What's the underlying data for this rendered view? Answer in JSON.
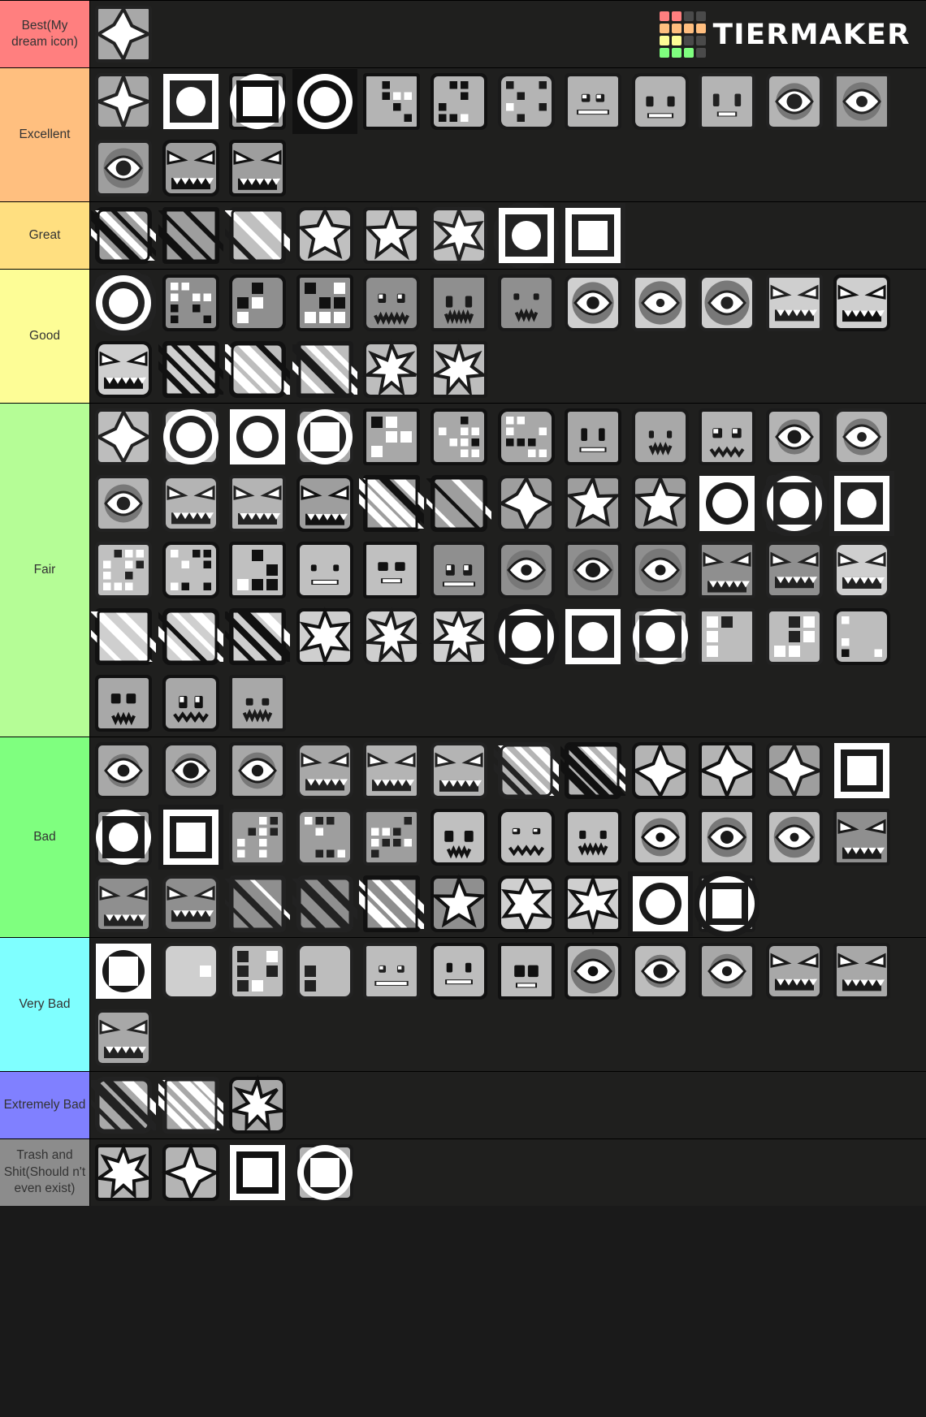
{
  "brand": {
    "name": "TIERMAKER",
    "logo_icon": "tiermaker-grid-logo",
    "logo_colors": [
      "#ff7f7f",
      "#ff7f7f",
      "#4a4a4a",
      "#4a4a4a",
      "#ffbe7f",
      "#ffbe7f",
      "#ffbe7f",
      "#ffbe7f",
      "#fdfd96",
      "#fdfd96",
      "#4a4a4a",
      "#4a4a4a",
      "#7fff7f",
      "#7fff7f",
      "#7fff7f",
      "#4a4a4a"
    ]
  },
  "palette": {
    "background": "#1a1a1a",
    "cell_background": "#1f1f1e",
    "divider": "#000000",
    "label_text": "#333333"
  },
  "tiers": [
    {
      "label": "Best(My dream icon)",
      "color": "#ff7f7f",
      "count": 1
    },
    {
      "label": "Excellent",
      "color": "#ffbf7f",
      "count": 15
    },
    {
      "label": "Great",
      "color": "#ffdf80",
      "count": 8
    },
    {
      "label": "Good",
      "color": "#fdfd96",
      "count": 18
    },
    {
      "label": "Fair",
      "color": "#b5fd96",
      "count": 51
    },
    {
      "label": "Bad",
      "color": "#7fff7f",
      "count": 34
    },
    {
      "label": "Very Bad",
      "color": "#7fffff",
      "count": 13
    },
    {
      "label": "Extremely Bad",
      "color": "#8080ff",
      "count": 3
    },
    {
      "label": "Trash and Shit(Should n't even exist)",
      "color": "#8c8c8c",
      "count": 4
    }
  ],
  "item_label": "geometry-dash-icon"
}
